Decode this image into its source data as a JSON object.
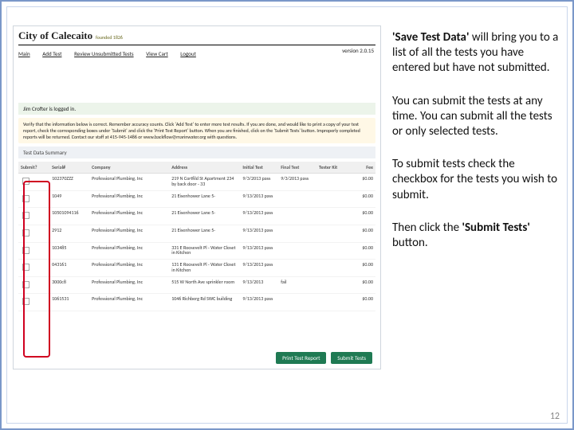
{
  "domain": "Document",
  "slide": {
    "page_number": "12"
  },
  "right_panel": {
    "p1_bold": "'Save Test Data'",
    "p1_rest": " will bring you to a list of all the tests you have entered but have not submitted.",
    "p2": "You can submit the tests at any time. You can submit all the tests or only selected tests.",
    "p3": "To submit tests check the checkbox for the tests you wish to submit.",
    "p4_a": "Then click the ",
    "p4_bold": "'Submit Tests'",
    "p4_b": " button."
  },
  "app": {
    "city": "City of Calecaito",
    "founded": "founded 1826",
    "version": "version 2.0.15",
    "nav": {
      "main": "Main",
      "add_test": "Add Test",
      "review": "Review Unsubmitted Tests",
      "view_cart": "View Cart",
      "logout": "Logout"
    },
    "logged_in": "Jim Crofter is logged in.",
    "instructions": "Verify that the information below is correct. Remember accuracy counts. Click 'Add Test' to enter more test results. If you are done, and would like to print a copy of your test report, check the corresponding boxes under 'Submit' and click the 'Print Test Report' button. When you are finished, click on the 'Submit Tests' button. Improperly completed reports will be returned. Contact our staff at 415-945-1486 or www.backflow@marinwater.org with questions.",
    "summary_label": "Test Data Summary",
    "columns": {
      "submit": "Submit?",
      "serial": "Serial#",
      "company": "Company",
      "address": "Address",
      "initial_test": "Initial Test",
      "final_test": "Final Test",
      "tester_kit": "Tester Kit",
      "fee": "Fee"
    },
    "rows": [
      {
        "serial": "102370ZZZ",
        "company": "Professional Plumbing, Inc",
        "address": "219 N Cortfild St Apartment 234 by back door - 33",
        "initial": "9/3/2013 pass",
        "final": "9/3/2013 pass",
        "kit": "",
        "fee": "$0.00"
      },
      {
        "serial": "1049",
        "company": "Professional Plumbing, Inc",
        "address": "21 Eisenhower Lane 5-",
        "initial": "9/13/2013 pass",
        "final": "",
        "kit": "",
        "fee": "$0.00"
      },
      {
        "serial": "10501094116",
        "company": "Professional Plumbing, Inc",
        "address": "21 Eisenhower Lane 5-",
        "initial": "9/13/2013 pass",
        "final": "",
        "kit": "",
        "fee": "$0.00"
      },
      {
        "serial": "2912",
        "company": "Professional Plumbing, Inc",
        "address": "21 Eisenhower Lane 5-",
        "initial": "9/13/2013 pass",
        "final": "",
        "kit": "",
        "fee": "$0.00"
      },
      {
        "serial": "103485",
        "company": "Professional Plumbing, Inc",
        "address": "331 E Roosevelt Pl - Water Closet in Kitchen",
        "initial": "9/13/2013 pass",
        "final": "",
        "kit": "",
        "fee": "$0.00"
      },
      {
        "serial": "043161",
        "company": "Professional Plumbing, Inc",
        "address": "131 E Roosevelt Pl - Water Closet in Kitchen",
        "initial": "9/13/2013 pass",
        "final": "",
        "kit": "",
        "fee": "$0.00"
      },
      {
        "serial": "3000c8",
        "company": "Professional Plumbing, Inc",
        "address": "515 W North Ave sprinkler room",
        "initial": "9/13/2013",
        "final": "fail",
        "kit": "",
        "fee": "$0.00"
      },
      {
        "serial": "1061531",
        "company": "Professional Plumbing, Inc",
        "address": "1046 Richberg Rd SWC building",
        "initial": "9/13/2013 pass",
        "final": "",
        "kit": "",
        "fee": "$0.00"
      }
    ],
    "buttons": {
      "print": "Print Test Report",
      "submit": "Submit Tests"
    }
  }
}
